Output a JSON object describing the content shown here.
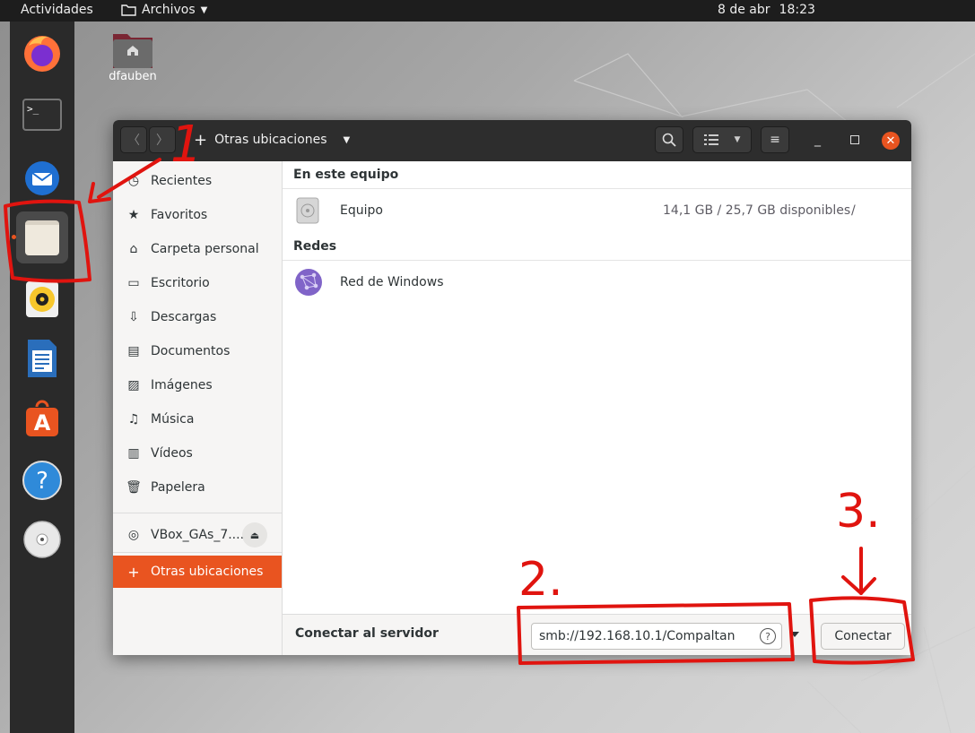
{
  "topbar": {
    "activities": "Actividades",
    "app_menu": "Archivos",
    "date": "8 de abr",
    "time": "18:23"
  },
  "desktop": {
    "home_icon_label": "dfauben"
  },
  "window": {
    "path_label": "Otras ubicaciones",
    "sidebar": {
      "items": [
        {
          "label": "Recientes",
          "icon": "clock-icon"
        },
        {
          "label": "Favoritos",
          "icon": "star-icon"
        },
        {
          "label": "Carpeta personal",
          "icon": "home-icon"
        },
        {
          "label": "Escritorio",
          "icon": "desktop-icon"
        },
        {
          "label": "Descargas",
          "icon": "download-icon"
        },
        {
          "label": "Documentos",
          "icon": "document-icon"
        },
        {
          "label": "Imágenes",
          "icon": "image-icon"
        },
        {
          "label": "Música",
          "icon": "music-icon"
        },
        {
          "label": "Vídeos",
          "icon": "video-icon"
        },
        {
          "label": "Papelera",
          "icon": "trash-icon"
        }
      ],
      "device": "VBox_GAs_7....",
      "other_locations": "Otras ubicaciones"
    },
    "main": {
      "section_this_computer": "En este equipo",
      "computer_label": "Equipo",
      "computer_space": "14,1 GB / 25,7 GB disponibles",
      "computer_path": "/",
      "section_networks": "Redes",
      "network_label": "Red de Windows"
    },
    "footer": {
      "label": "Conectar al servidor",
      "server_value": "smb://192.168.10.1/Compaltan",
      "connect_button": "Conectar"
    }
  },
  "annotations": {
    "step1": "1",
    "step2": "2.",
    "step3": "3."
  },
  "colors": {
    "accent": "#e95420",
    "annotation": "#e0140f"
  }
}
